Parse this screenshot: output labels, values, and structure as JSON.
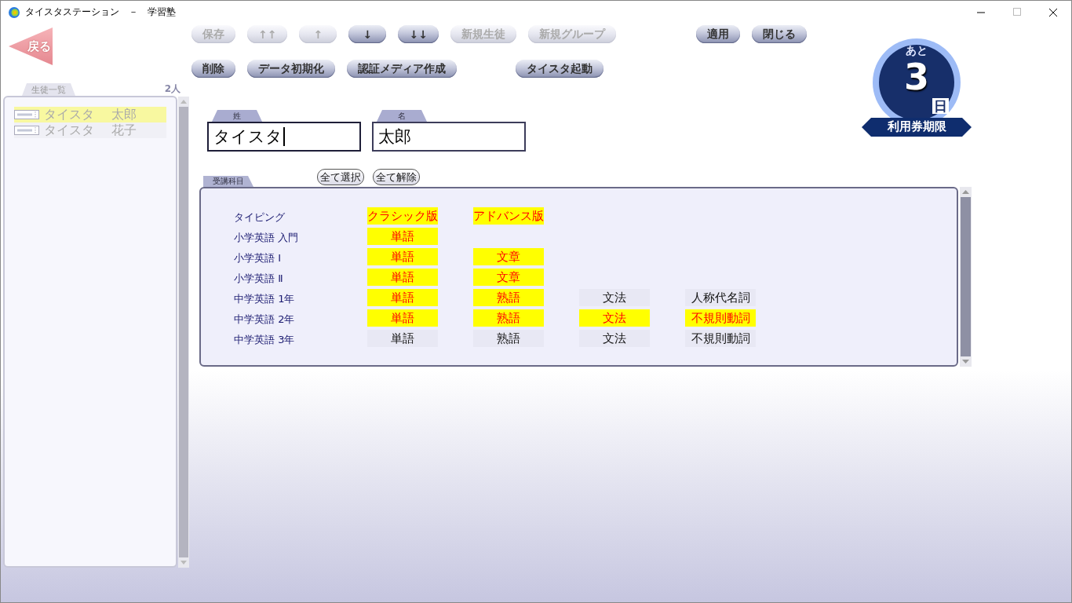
{
  "window": {
    "title": "タイスタステーション　－　学習塾"
  },
  "back_button": {
    "label": "戻る"
  },
  "toolbar": [
    {
      "groups": [
        {
          "buttons": [
            {
              "label": "保存",
              "disabled": true
            },
            {
              "label": "↑↑",
              "disabled": true
            },
            {
              "label": "↑",
              "disabled": true
            },
            {
              "label": "↓",
              "disabled": false
            },
            {
              "label": "↓↓",
              "disabled": false
            },
            {
              "label": "新規生徒",
              "disabled": true
            },
            {
              "label": "新規グループ",
              "disabled": true
            }
          ]
        },
        {
          "buttons": [
            {
              "label": "適用",
              "disabled": false
            },
            {
              "label": "閉じる",
              "disabled": false
            }
          ]
        }
      ]
    },
    {
      "groups": [
        {
          "buttons": [
            {
              "label": "削除",
              "disabled": false
            },
            {
              "label": "データ初期化",
              "disabled": false
            },
            {
              "label": "認証メディア作成",
              "disabled": false
            }
          ]
        },
        {
          "buttons": [
            {
              "label": "タイスタ起動",
              "disabled": false
            }
          ]
        }
      ]
    }
  ],
  "student_list": {
    "title": "生徒一覧",
    "count": "2人",
    "students": [
      {
        "surname": "タイスタ",
        "given_name": "太郎",
        "selected": true
      },
      {
        "surname": "タイスタ",
        "given_name": "花子",
        "selected": false
      }
    ]
  },
  "fields": [
    {
      "label": "姓",
      "value": "タイスタ",
      "focused": true
    },
    {
      "label": "名",
      "value": "太郎",
      "focused": false
    }
  ],
  "badge": {
    "prefix": "あと",
    "days": "3",
    "unit": "日",
    "caption": "利用券期限"
  },
  "subjects": {
    "title": "受講科目",
    "actions": [
      {
        "label": "全て選択"
      },
      {
        "label": "全て解除"
      }
    ],
    "rows": [
      {
        "name": "タイピング",
        "options": [
          {
            "label": "クラシック版",
            "selected": true
          },
          {
            "label": "アドバンス版",
            "selected": true
          }
        ]
      },
      {
        "name": "小学英語 入門",
        "options": [
          {
            "label": "単語",
            "selected": true
          }
        ]
      },
      {
        "name": "小学英語 Ⅰ",
        "options": [
          {
            "label": "単語",
            "selected": true
          },
          {
            "label": "文章",
            "selected": true
          }
        ]
      },
      {
        "name": "小学英語 Ⅱ",
        "options": [
          {
            "label": "単語",
            "selected": true
          },
          {
            "label": "文章",
            "selected": true
          }
        ]
      },
      {
        "name": "中学英語 1年",
        "options": [
          {
            "label": "単語",
            "selected": true
          },
          {
            "label": "熟語",
            "selected": true
          },
          {
            "label": "文法",
            "selected": false
          },
          {
            "label": "人称代名詞",
            "selected": false
          }
        ]
      },
      {
        "name": "中学英語 2年",
        "options": [
          {
            "label": "単語",
            "selected": true
          },
          {
            "label": "熟語",
            "selected": true
          },
          {
            "label": "文法",
            "selected": true
          },
          {
            "label": "不規則動詞",
            "selected": true
          }
        ]
      },
      {
        "name": "中学英語 3年",
        "options": [
          {
            "label": "単語",
            "selected": false
          },
          {
            "label": "熟語",
            "selected": false
          },
          {
            "label": "文法",
            "selected": false
          },
          {
            "label": "不規則動詞",
            "selected": false
          }
        ]
      }
    ]
  }
}
